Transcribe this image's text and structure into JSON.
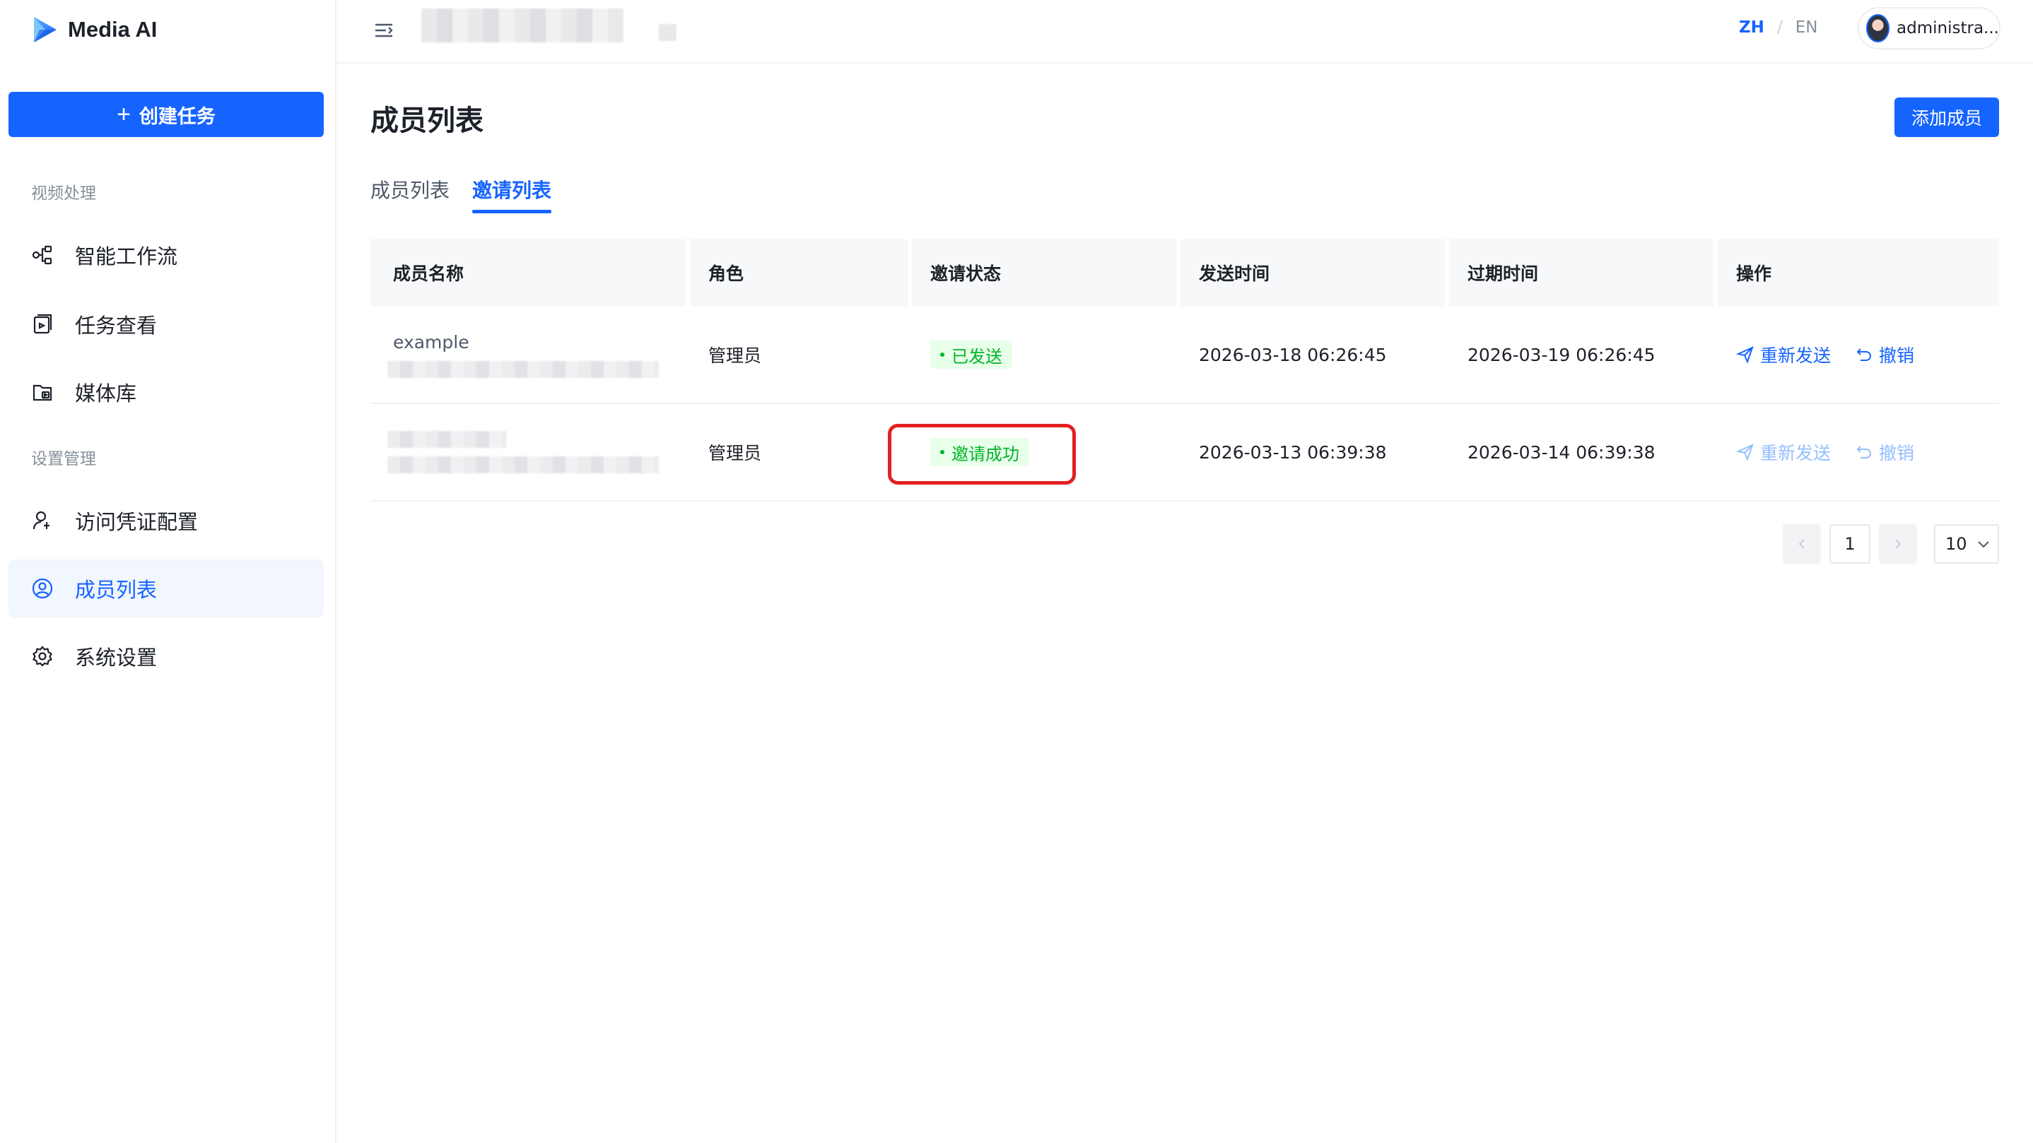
{
  "app": {
    "name": "Media AI",
    "create_label": "创建任务"
  },
  "sidebar": {
    "groups": [
      {
        "label": "视频处理"
      },
      {
        "label": "设置管理"
      }
    ],
    "items": [
      {
        "label": "智能工作流",
        "icon": "workflow-icon"
      },
      {
        "label": "任务查看",
        "icon": "task-list-icon"
      },
      {
        "label": "媒体库",
        "icon": "media-library-icon"
      },
      {
        "label": "访问凭证配置",
        "icon": "user-key-icon"
      },
      {
        "label": "成员列表",
        "icon": "user-circle-icon",
        "active": true
      },
      {
        "label": "系统设置",
        "icon": "gear-icon"
      }
    ]
  },
  "topbar": {
    "lang_zh": "ZH",
    "lang_sep": "/",
    "lang_en": "EN",
    "user_name": "administra..."
  },
  "page": {
    "title": "成员列表",
    "add_button": "添加成员",
    "tabs": [
      {
        "label": "成员列表",
        "active": false
      },
      {
        "label": "邀请列表",
        "active": true
      }
    ]
  },
  "table": {
    "headers": [
      "成员名称",
      "角色",
      "邀请状态",
      "发送时间",
      "过期时间",
      "操作"
    ],
    "rows": [
      {
        "name": "example",
        "role": "管理员",
        "status": "已发送",
        "sent_at": "2026-03-18 06:26:45",
        "expires_at": "2026-03-19 06:26:45",
        "action_resend": "重新发送",
        "action_revoke": "撤销",
        "actions_enabled": true
      },
      {
        "name": "",
        "role": "管理员",
        "status": "邀请成功",
        "sent_at": "2026-03-13 06:39:38",
        "expires_at": "2026-03-14 06:39:38",
        "action_resend": "重新发送",
        "action_revoke": "撤销",
        "actions_enabled": false
      }
    ]
  },
  "pagination": {
    "current_page": "1",
    "page_size": "10"
  },
  "colors": {
    "primary": "#1664ff",
    "success": "#00b42a",
    "highlight": "#e32020"
  }
}
